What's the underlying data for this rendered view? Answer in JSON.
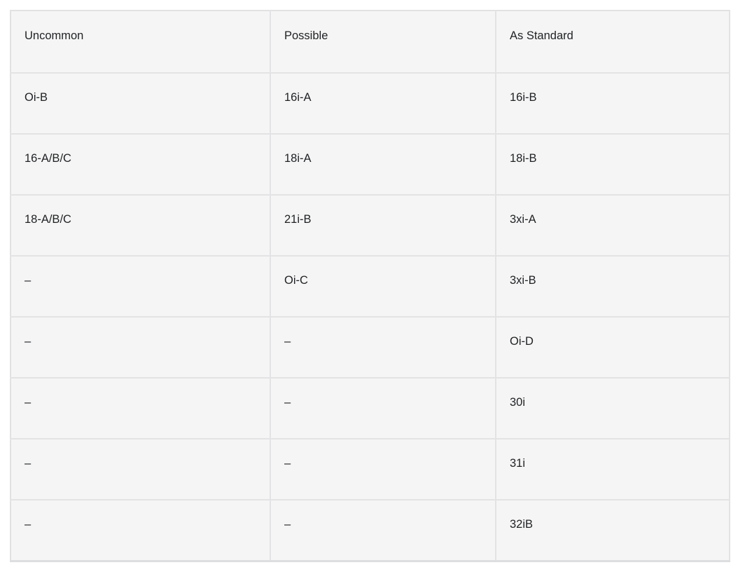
{
  "table": {
    "headers": [
      {
        "label": "Uncommon"
      },
      {
        "label": "Possible"
      },
      {
        "label": "As Standard"
      }
    ],
    "rows": [
      {
        "uncommon": "Oi-B",
        "possible": "16i-A",
        "as_standard": "16i-B"
      },
      {
        "uncommon": "16-A/B/C",
        "possible": "18i-A",
        "as_standard": "18i-B"
      },
      {
        "uncommon": "18-A/B/C",
        "possible": "21i-B",
        "as_standard": "3xi-A"
      },
      {
        "uncommon": "–",
        "possible": "Oi-C",
        "as_standard": "3xi-B"
      },
      {
        "uncommon": "–",
        "possible": "–",
        "as_standard": "Oi-D"
      },
      {
        "uncommon": "–",
        "possible": "–",
        "as_standard": "30i"
      },
      {
        "uncommon": "–",
        "possible": "–",
        "as_standard": "31i"
      },
      {
        "uncommon": "–",
        "possible": "–",
        "as_standard": "32iB"
      }
    ]
  },
  "style": {
    "cell_background": "#f5f5f5",
    "border_color": "#e3e3e5",
    "text_color": "#1f2124",
    "page_background": "#ffffff"
  }
}
